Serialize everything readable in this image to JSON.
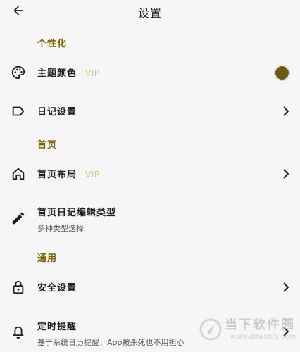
{
  "header": {
    "title": "设置"
  },
  "sections": {
    "personalization": "个性化",
    "home": "首页",
    "general": "通用"
  },
  "items": {
    "theme_color": {
      "label": "主题颜色",
      "badge": "VIP",
      "color": "#6b5a12"
    },
    "diary_settings": {
      "label": "日记设置"
    },
    "home_layout": {
      "label": "首页布局",
      "badge": "VIP"
    },
    "home_diary_edit_type": {
      "label": "首页日记编辑类型",
      "subtitle": "多种类型选择"
    },
    "security_settings": {
      "label": "安全设置"
    },
    "reminder": {
      "label": "定时提醒",
      "subtitle": "基于系统日历提醒，App被杀死也不用担心"
    }
  },
  "watermark": {
    "title": "当下软件园",
    "url": "www.downxia.com"
  },
  "colors": {
    "accent": "#7a6300",
    "vip": "#e2c84f",
    "text": "#1e1e1e",
    "background": "#f6f6f6"
  }
}
